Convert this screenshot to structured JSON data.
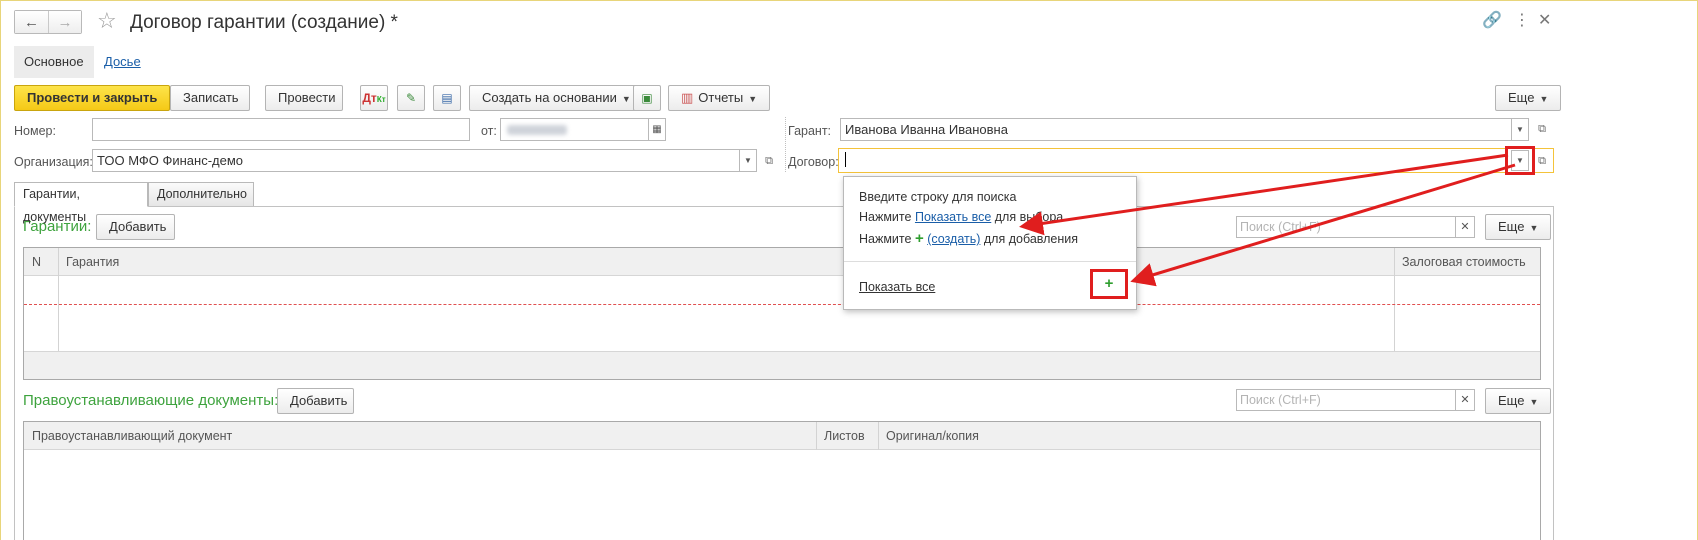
{
  "window": {
    "title": "Договор гарантии (создание) *",
    "back_icon": "←",
    "forward_icon": "→",
    "star_icon": "☆",
    "link_icon": "🔗",
    "more_icon": "⋮",
    "close_icon": "✕"
  },
  "top_tabs": [
    {
      "label": "Основное"
    },
    {
      "label": "Досье"
    }
  ],
  "toolbar": {
    "post_close": "Провести и закрыть",
    "save": "Записать",
    "post": "Провести",
    "create_based_on": "Создать на основании",
    "reports": "Отчеты",
    "more": "Еще"
  },
  "fields": {
    "number_label": "Номер:",
    "number_value": "",
    "date_label": "от:",
    "org_label": "Организация:",
    "org_value": "ТОО МФО Финанс-демо",
    "guarantor_label": "Гарант:",
    "guarantor_value": "Иванова Иванна Ивановна",
    "contract_label": "Договор:",
    "contract_value": ""
  },
  "inner_tabs": [
    {
      "label": "Гарантии, документы"
    },
    {
      "label": "Дополнительно"
    }
  ],
  "guarantees": {
    "title": "Гарантии:",
    "add": "Добавить",
    "search_placeholder": "Поиск (Ctrl+F)",
    "more": "Еще",
    "columns": [
      "N",
      "Гарантия",
      "Залоговая стоимость"
    ]
  },
  "title_docs": {
    "title": "Правоустанавливающие документы:",
    "add": "Добавить",
    "search_placeholder": "Поиск (Ctrl+F)",
    "more": "Еще",
    "columns": [
      "Правоустанавливающий документ",
      "Листов",
      "Оригинал/копия"
    ]
  },
  "popup": {
    "line1": "Введите строку для поиска",
    "line2_prefix": "Нажмите",
    "line2_link": "Показать все",
    "line2_suffix": "для выбора",
    "line3_prefix": "Нажмите",
    "line3_link": "(создать)",
    "line3_suffix": "для добавления",
    "show_all": "Показать все"
  },
  "colors": {
    "accent_yellow": "#f5c916",
    "section_green": "#3ea33e",
    "annotation_red": "#e01e1e",
    "link_blue": "#1a5ea8"
  }
}
